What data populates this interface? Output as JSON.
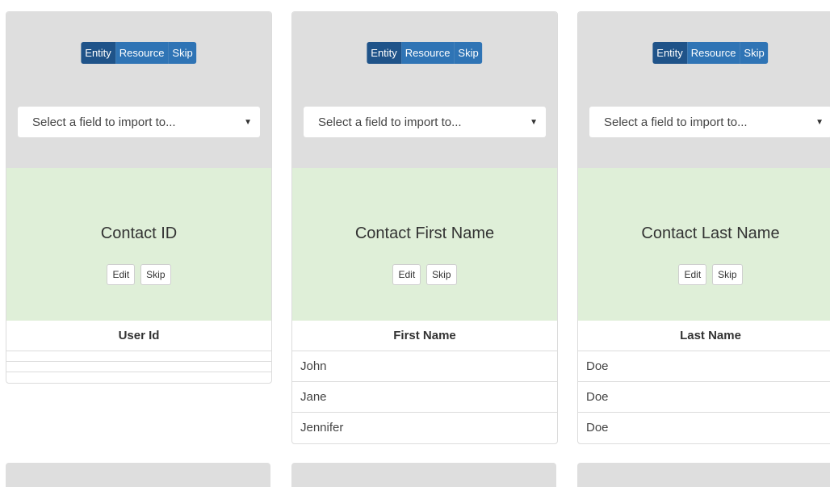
{
  "segment_labels": {
    "entity": "Entity",
    "resource": "Resource",
    "skip": "Skip"
  },
  "select_placeholder": "Select a field to import to...",
  "select_caret": "▼",
  "buttons": {
    "edit": "Edit",
    "skip": "Skip"
  },
  "columns": [
    {
      "title": "Contact ID",
      "header": "User Id",
      "rows": [
        "",
        "",
        ""
      ]
    },
    {
      "title": "Contact First Name",
      "header": "First Name",
      "rows": [
        "John",
        "Jane",
        "Jennifer"
      ]
    },
    {
      "title": "Contact Last Name",
      "header": "Last Name",
      "rows": [
        "Doe",
        "Doe",
        "Doe"
      ]
    }
  ],
  "colors": {
    "segment_active": "#1f5389",
    "segment": "#2f74b5",
    "top_panel": "#dedede",
    "mapped_panel": "#dfefd8"
  }
}
